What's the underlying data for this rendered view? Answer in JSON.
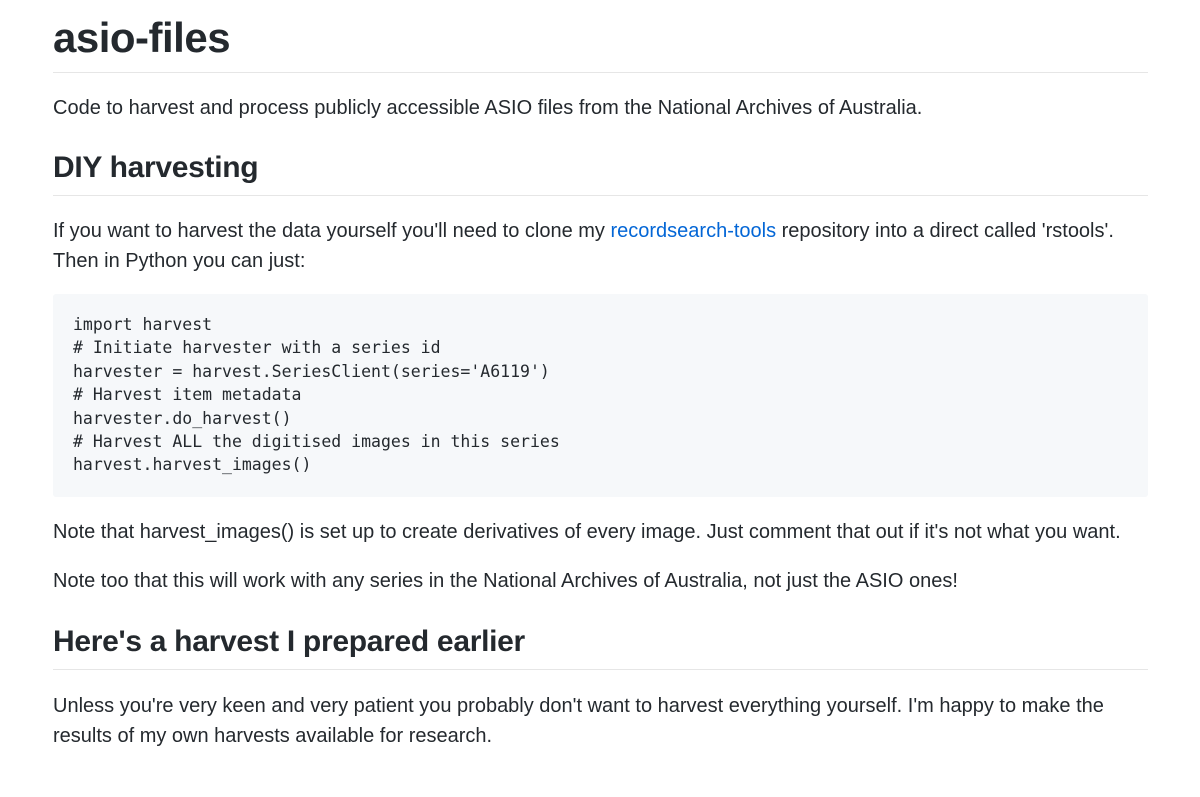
{
  "title": "asio-files",
  "intro": "Code to harvest and process publicly accessible ASIO files from the National Archives of Australia.",
  "diy": {
    "heading": "DIY harvesting",
    "text_before_link": "If you want to harvest the data yourself you'll need to clone my ",
    "link_text": "recordsearch-tools",
    "text_after_link": " repository into a direct called 'rstools'. Then in Python you can just:",
    "code_lines": [
      "import harvest",
      "# Initiate harvester with a series id",
      "harvester = harvest.SeriesClient(series='A6119')",
      "# Harvest item metadata",
      "harvester.do_harvest()",
      "# Harvest ALL the digitised images in this series",
      "harvest.harvest_images()"
    ],
    "note1": "Note that harvest_images() is set up to create derivatives of every image. Just comment that out if it's not what you want.",
    "note2": "Note too that this will work with any series in the National Archives of Australia, not just the ASIO ones!"
  },
  "prepared": {
    "heading": "Here's a harvest I prepared earlier",
    "text": "Unless you're very keen and very patient you probably don't want to harvest everything yourself. I'm happy to make the results of my own harvests available for research."
  },
  "colors": {
    "link": "#0366d6",
    "text": "#24292e",
    "code_bg": "#f6f8fa"
  }
}
